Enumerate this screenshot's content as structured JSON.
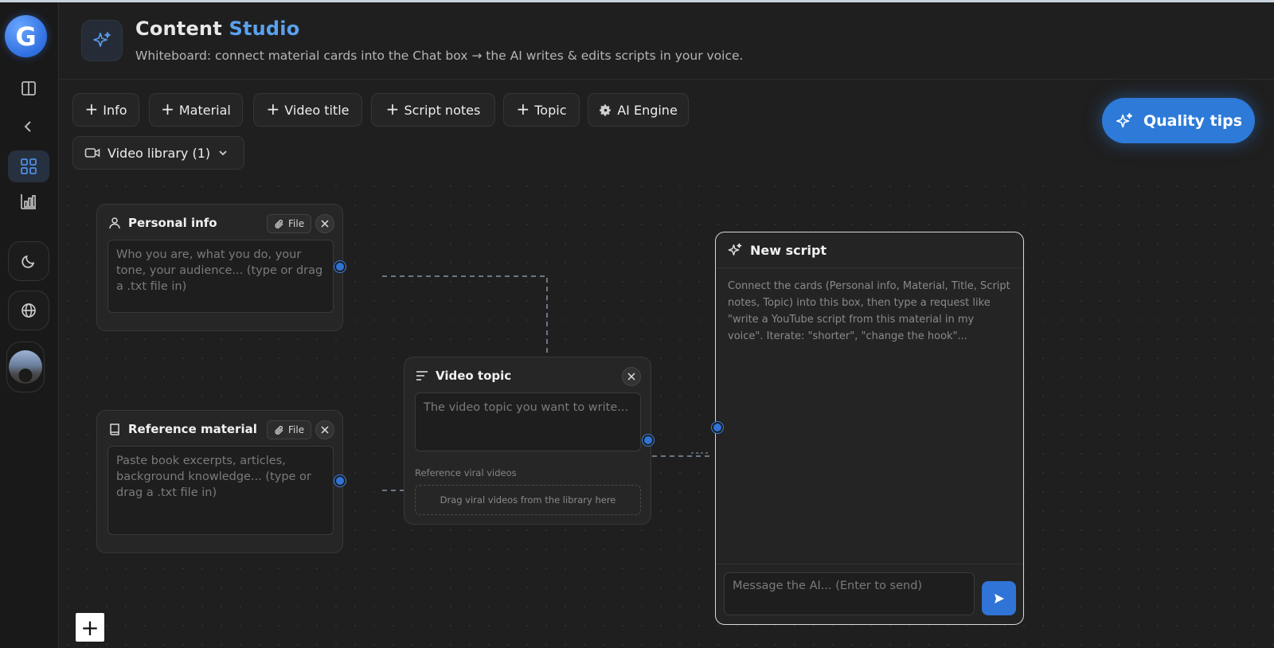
{
  "header": {
    "title_main": "Content",
    "title_accent": "Studio",
    "subtitle": "Whiteboard: connect material cards into the Chat box → the AI writes & edits scripts in your voice."
  },
  "toolbar": {
    "buttons": [
      "Info",
      "Material",
      "Video title",
      "Script notes",
      "Topic"
    ],
    "ai_engine": "AI Engine",
    "video_library": "Video library (1)",
    "quality_tips": "Quality tips"
  },
  "cards": {
    "personal_info": {
      "title": "Personal info",
      "file_label": "File",
      "placeholder": "Who you are, what you do, your tone, your audience... (type or drag a .txt file in)"
    },
    "reference_material": {
      "title": "Reference material",
      "file_label": "File",
      "placeholder": "Paste book excerpts, articles, background knowledge... (type or drag a .txt file in)"
    },
    "video_topic": {
      "title": "Video topic",
      "placeholder": "The video topic you want to write...",
      "viral_label": "Reference viral videos",
      "viral_drop": "Drag viral videos from the library here"
    }
  },
  "script": {
    "title": "New script",
    "hint": "Connect the cards (Personal info, Material, Title, Script notes, Topic) into this box, then type a request like \"write a YouTube script from this material in my voice\". Iterate: \"shorter\", \"change the hook\"...",
    "input_placeholder": "Message the AI... (Enter to send)"
  },
  "sidebar": {
    "logo_letter": "G",
    "icons": [
      "sidebar-panel-icon",
      "chevron-left-icon",
      "grid-icon",
      "bar-chart-icon",
      "moon-icon",
      "globe-icon"
    ]
  },
  "zoom": {
    "plus_label": "+"
  },
  "colors": {
    "accent": "#2f74d6",
    "accent_text": "#5aa2ee",
    "background": "#1f1f1f"
  }
}
